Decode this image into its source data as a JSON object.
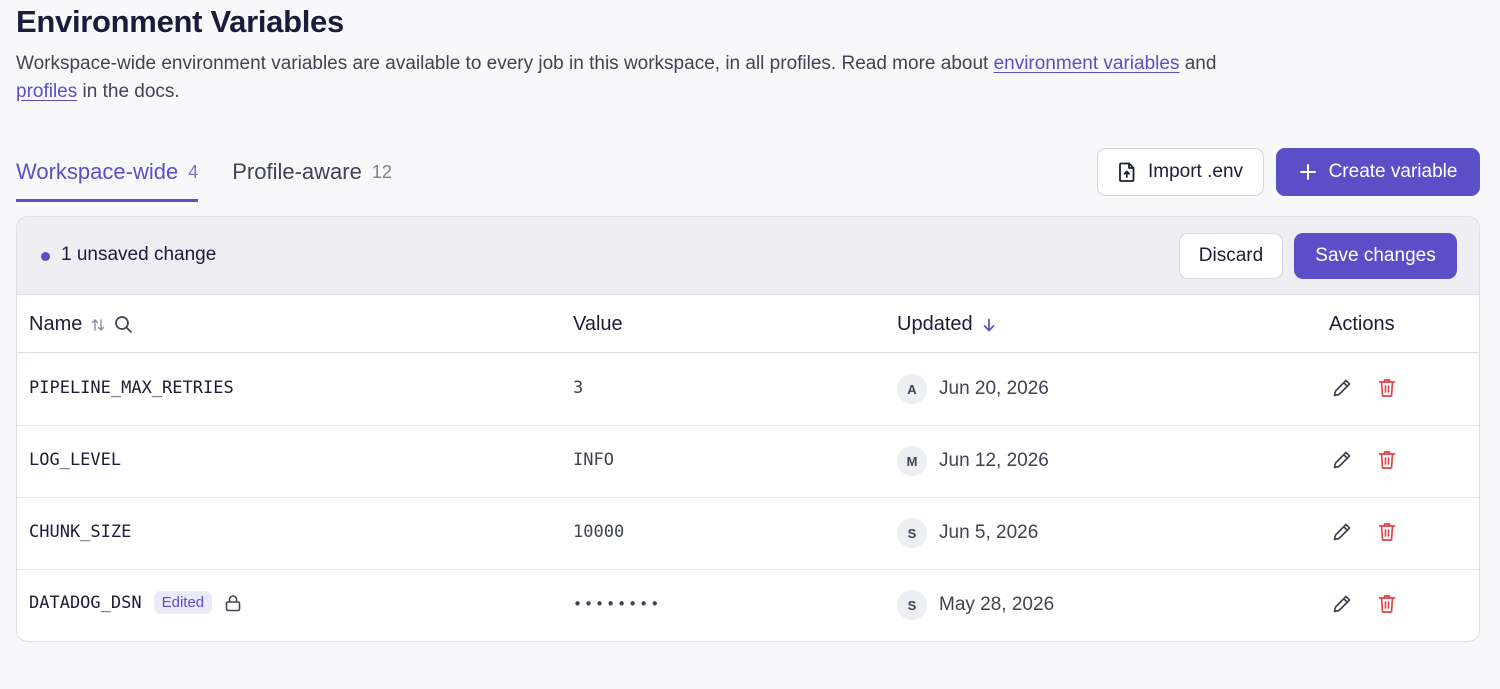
{
  "header": {
    "title": "Environment Variables",
    "desc_part1": "Workspace-wide environment variables are available to every job in this workspace, in all profiles. Read more about ",
    "link_env": "environment variables",
    "desc_and": " and ",
    "link_profiles": "profiles",
    "desc_end": " in the docs."
  },
  "tabs": [
    {
      "label": "Workspace-wide",
      "count": "4",
      "active": true
    },
    {
      "label": "Profile-aware",
      "count": "12",
      "active": false
    }
  ],
  "toolbar": {
    "import_label": "Import .env",
    "create_label": "Create variable"
  },
  "unsaved": {
    "text": "1 unsaved change",
    "discard_label": "Discard",
    "save_label": "Save changes"
  },
  "table": {
    "columns": {
      "name": "Name",
      "value": "Value",
      "updated": "Updated",
      "actions": "Actions"
    },
    "rows": [
      {
        "name": "PIPELINE_MAX_RETRIES",
        "value": "3",
        "avatar": "A",
        "date": "Jun 20, 2026"
      },
      {
        "name": "LOG_LEVEL",
        "value": "INFO",
        "avatar": "M",
        "date": "Jun 12, 2026"
      },
      {
        "name": "CHUNK_SIZE",
        "value": "10000",
        "avatar": "S",
        "date": "Jun 5, 2026"
      },
      {
        "name": "DATADOG_DSN",
        "value": "••••••••",
        "avatar": "S",
        "date": "May 28, 2026",
        "badge": "Edited",
        "secret": true
      }
    ]
  },
  "colors": {
    "accent": "#5b4fc8",
    "danger": "#e0454a"
  }
}
